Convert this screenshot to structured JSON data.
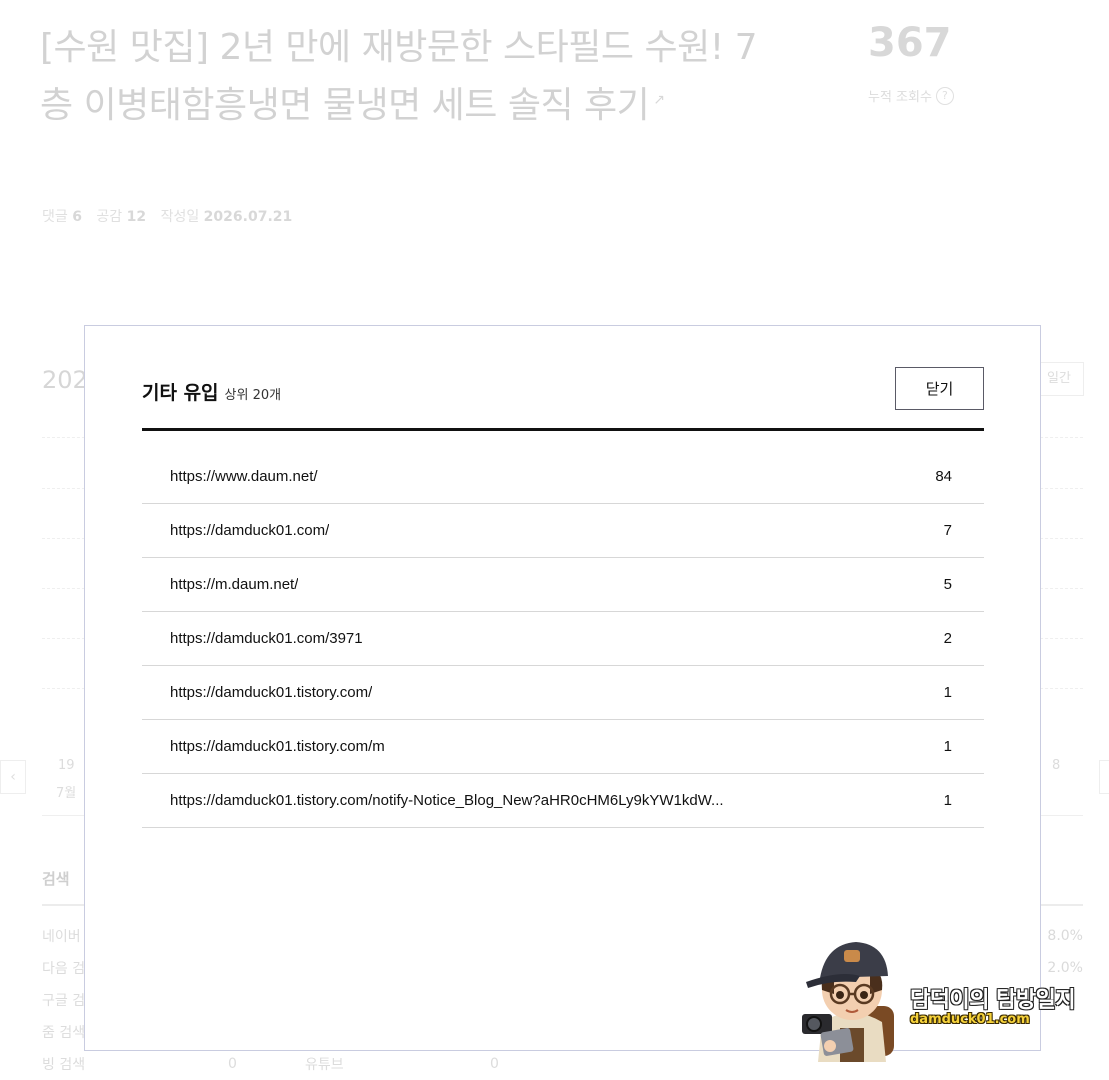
{
  "background": {
    "post_title": "[수원 맛집] 2년 만에 재방문한 스타필드 수원! 7층 이병태함흥냉면 물냉면 세트 솔직 후기",
    "meta": {
      "comments_label": "댓글",
      "comments": "6",
      "likes_label": "공감",
      "likes": "12",
      "date_label": "작성일",
      "date": "2026.07.21"
    },
    "views": "367",
    "views_label": "누적 조회수",
    "help_glyph": "?",
    "year_partial": "202",
    "period_button_partial": "일간",
    "axis_left_day": "19",
    "axis_left_month": "7월",
    "axis_right_day": "8",
    "nav_prev": "‹",
    "search_section": "검색",
    "search_rows": [
      "네이버",
      "다음 검",
      "구글 검",
      "줌 검색",
      "빙 검색"
    ],
    "bing_value": "0",
    "youtube_label": "유튜브",
    "youtube_value": "0",
    "percent_1": "8.0%",
    "percent_2": "2.0%"
  },
  "modal": {
    "title": "기타 유입",
    "subtitle": "상위 20개",
    "close_label": "닫기",
    "rows": [
      {
        "url": "https://www.daum.net/",
        "count": "84"
      },
      {
        "url": "https://damduck01.com/",
        "count": "7"
      },
      {
        "url": "https://m.daum.net/",
        "count": "5"
      },
      {
        "url": "https://damduck01.com/3971",
        "count": "2"
      },
      {
        "url": "https://damduck01.tistory.com/",
        "count": "1"
      },
      {
        "url": "https://damduck01.tistory.com/m",
        "count": "1"
      },
      {
        "url": "https://damduck01.tistory.com/notify-Notice_Blog_New?aHR0cHM6Ly9kYW1kdW...",
        "count": "1"
      }
    ]
  },
  "watermark": {
    "name": "담덕이의 탐방일지",
    "site": "damduck01.com"
  }
}
